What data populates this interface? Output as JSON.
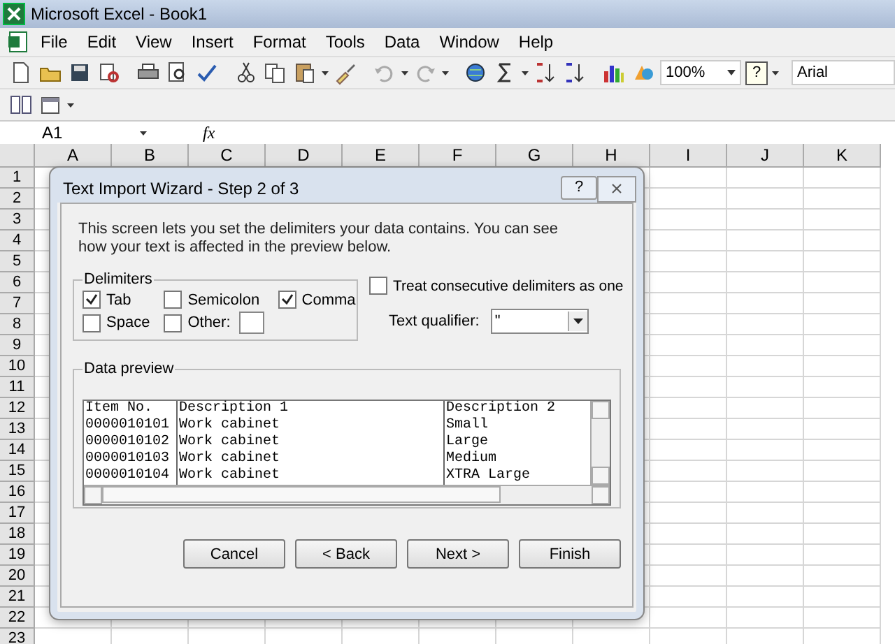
{
  "window": {
    "title": "Microsoft Excel - Book1"
  },
  "menu": [
    "File",
    "Edit",
    "View",
    "Insert",
    "Format",
    "Tools",
    "Data",
    "Window",
    "Help"
  ],
  "toolbar": {
    "zoom": "100%",
    "help": "?",
    "font": "Arial"
  },
  "formula_bar": {
    "name_box": "A1",
    "fx": "fx"
  },
  "sheet": {
    "columns": [
      "A",
      "B",
      "C",
      "D",
      "E",
      "F",
      "G",
      "H",
      "I",
      "J",
      "K"
    ],
    "rows": [
      "1",
      "2",
      "3",
      "4",
      "5",
      "6",
      "7",
      "8",
      "9",
      "10",
      "11",
      "12",
      "13",
      "14",
      "15",
      "16",
      "17",
      "18",
      "19",
      "20",
      "21",
      "22",
      "23"
    ]
  },
  "dialog": {
    "title": "Text Import Wizard - Step 2 of 3",
    "help": "?",
    "intro": "This screen lets you set the delimiters your data contains.  You can see how your text is affected in the preview below.",
    "delimiters_label": "Delimiters",
    "delimiters": [
      {
        "label": "Tab",
        "checked": true
      },
      {
        "label": "Semicolon",
        "checked": false
      },
      {
        "label": "Comma",
        "checked": true
      },
      {
        "label": "Space",
        "checked": false
      },
      {
        "label": "Other:",
        "checked": false
      }
    ],
    "consecutive": {
      "label": "Treat consecutive delimiters as one",
      "checked": false
    },
    "qualifier": {
      "label": "Text qualifier:",
      "value": "\""
    },
    "preview_label": "Data preview",
    "preview_rows": [
      [
        "Item No.",
        "Description 1",
        "Description 2"
      ],
      [
        "0000010101",
        "Work cabinet",
        "Small"
      ],
      [
        "0000010102",
        "Work cabinet",
        "Large"
      ],
      [
        "0000010103",
        "Work cabinet",
        "Medium"
      ],
      [
        "0000010104",
        "Work cabinet",
        "XTRA Large"
      ]
    ],
    "buttons": [
      "Cancel",
      "< Back",
      "Next >",
      "Finish"
    ]
  }
}
